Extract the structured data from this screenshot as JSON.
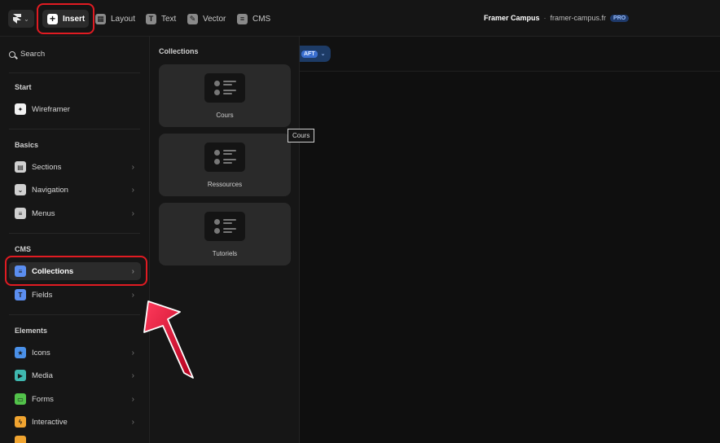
{
  "toolbar": {
    "insert_label": "Insert",
    "layout_label": "Layout",
    "text_label": "Text",
    "vector_label": "Vector",
    "cms_label": "CMS"
  },
  "site": {
    "name": "Framer Campus",
    "separator": "·",
    "domain": "framer-campus.fr",
    "plan_badge": "PRO"
  },
  "left_panel": {
    "search_placeholder": "Search",
    "sections": {
      "start": "Start",
      "basics": "Basics",
      "cms": "CMS",
      "elements": "Elements"
    },
    "items": {
      "wireframer": "Wireframer",
      "sections": "Sections",
      "navigation": "Navigation",
      "menus": "Menus",
      "collections": "Collections",
      "fields": "Fields",
      "icons": "Icons",
      "media": "Media",
      "forms": "Forms",
      "interactive": "Interactive"
    }
  },
  "collections_panel": {
    "title": "Collections",
    "cards": [
      "Cours",
      "Ressources",
      "Tutoriels"
    ]
  },
  "canvas": {
    "badge_text": "AFT",
    "tooltip": "Cours"
  },
  "colors": {
    "highlight": "#e11b22",
    "accent_blue": "#3a6fd0"
  }
}
